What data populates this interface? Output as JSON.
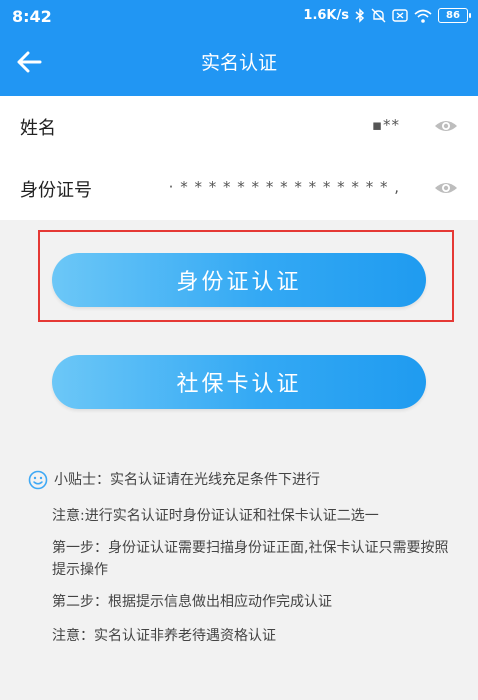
{
  "status_bar": {
    "time": "8:42",
    "network_speed": "1.6K/s",
    "battery_level": "86",
    "icons": [
      "bluetooth-icon",
      "mute-icon",
      "sim-x-icon",
      "wifi-icon",
      "battery-icon"
    ]
  },
  "header": {
    "title": "实名认证",
    "back_icon": "arrow-left-icon",
    "color": "#2196f3"
  },
  "form": {
    "name": {
      "label": "姓名",
      "value": "▪**"
    },
    "id_number": {
      "label": "身份证号",
      "value": "·  * * * * * * * * * * * * * * *  ,"
    },
    "toggle_icon": "eye-icon"
  },
  "buttons": {
    "id_card_auth": "身份证认证",
    "social_card_auth": "社保卡认证",
    "accent_from": "#6cc7f7",
    "accent_to": "#1f9bf0"
  },
  "tips": {
    "heading": "小贴士：实名认证请在光线充足条件下进行",
    "line1": "注意:进行实名认证时身份证认证和社保卡认证二选一",
    "line2": "第一步：身份证认证需要扫描身份证正面,社保卡认证只需要按照提示操作",
    "line3": "第二步：根据提示信息做出相应动作完成认证",
    "line4": "注意：实名认证非养老待遇资格认证",
    "icon": "smile-icon"
  },
  "highlight_color": "#e53935"
}
